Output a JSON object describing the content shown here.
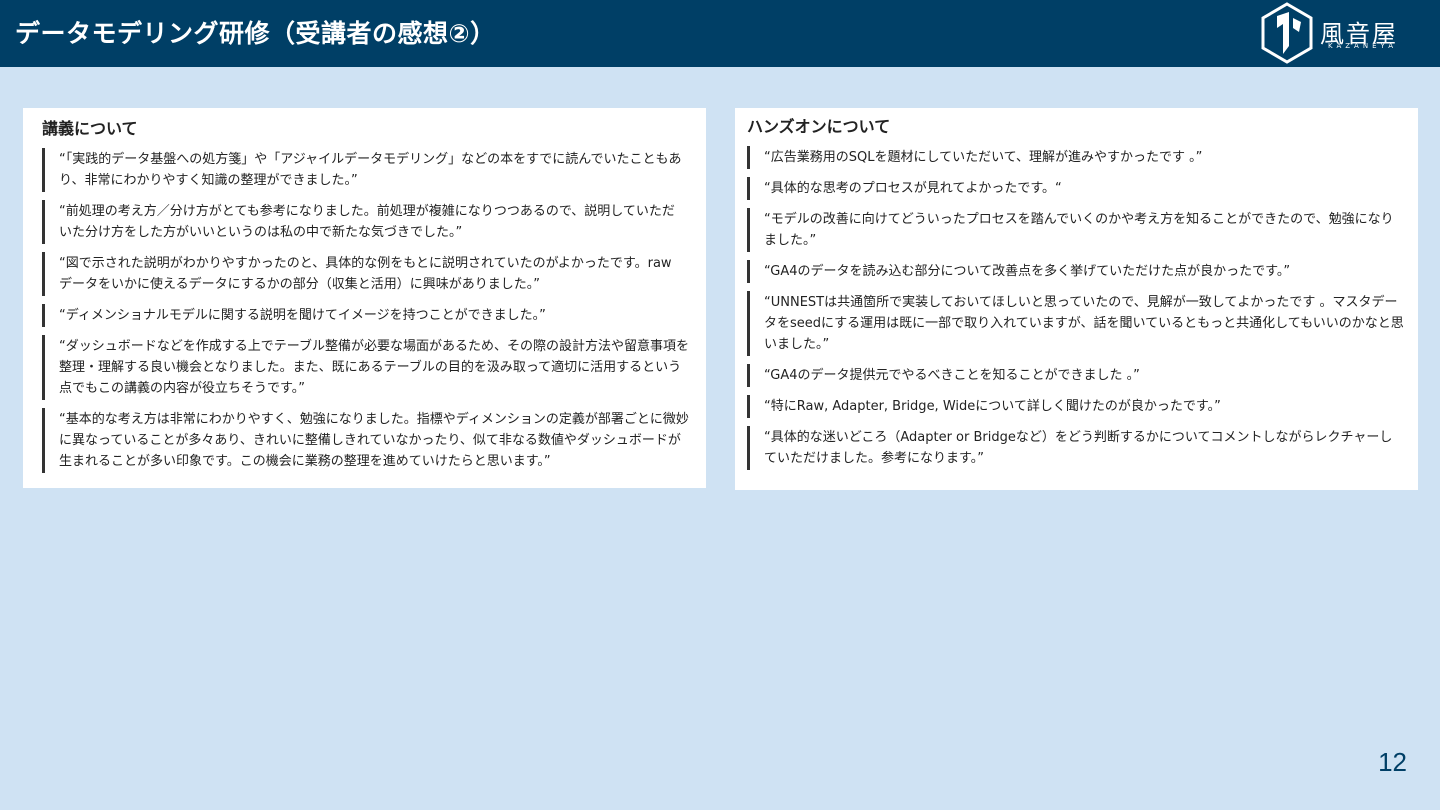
{
  "header": {
    "title": "データモデリング研修（受講者の感想②）",
    "background_color": "#003f66",
    "logo": {
      "name": "風音屋",
      "sub": "KAZANEYA",
      "icon": "kazaneya-logo-icon"
    }
  },
  "left_panel": {
    "heading": "講義について",
    "quotes": [
      "“「実践的データ基盤への処方箋」や「アジャイルデータモデリング」などの本をすでに読んでいたこともあり、非常にわかりやすく知識の整理ができました。”",
      "“前処理の考え方／分け方がとても参考になりました。前処理が複雑になりつつあるので、説明していただいた分け方をした方がいいというのは私の中で新たな気づきでした。”",
      "“図で示された説明がわかりやすかったのと、具体的な例をもとに説明されていたのがよかったです。rawデータをいかに使えるデータにするかの部分（収集と活用）に興味がありました。”",
      "“ディメンショナルモデルに関する説明を聞けてイメージを持つことができました。”",
      "“ダッシュボードなどを作成する上でテーブル整備が必要な場面があるため、その際の設計方法や留意事項を整理・理解する良い機会となりました。また、既にあるテーブルの目的を汲み取って適切に活用するという点でもこの講義の内容が役立ちそうです。”",
      "“基本的な考え方は非常にわかりやすく、勉強になりました。指標やディメンションの定義が部署ごとに微妙に異なっていることが多々あり、きれいに整備しきれていなかったり、似て非なる数値やダッシュボードが生まれることが多い印象です。この機会に業務の整理を進めていけたらと思います。”"
    ]
  },
  "right_panel": {
    "heading": "ハンズオンについて",
    "quotes": [
      "“広告業務用のSQLを題材にしていただいて、理解が進みやすかったです 。”",
      "“具体的な思考のプロセスが見れてよかったです。“",
      "“モデルの改善に向けてどういったプロセスを踏んでいくのかや考え方を知ることができたので、勉強になりました。”",
      "“GA4のデータを読み込む部分について改善点を多く挙げていただけた点が良かったです。”",
      "“UNNESTは共通箇所で実装しておいてほしいと思っていたので、見解が一致してよかったです 。マスタデータをseedにする運用は既に一部で取り入れていますが、話を聞いているともっと共通化してもいいのかなと思いました。”",
      "“GA4のデータ提供元でやるべきことを知ることができました 。”",
      "“特にRaw, Adapter, Bridge, Wideについて詳しく聞けたのが良かったです。”",
      "“具体的な迷いどころ（Adapter or Bridgeなど）をどう判断するかについてコメントしながらレクチャーしていただけました。参考になります。”"
    ]
  },
  "page_number": "12",
  "colors": {
    "background": "#cfe2f3",
    "panel": "#ffffff",
    "accent": "#003f66"
  }
}
